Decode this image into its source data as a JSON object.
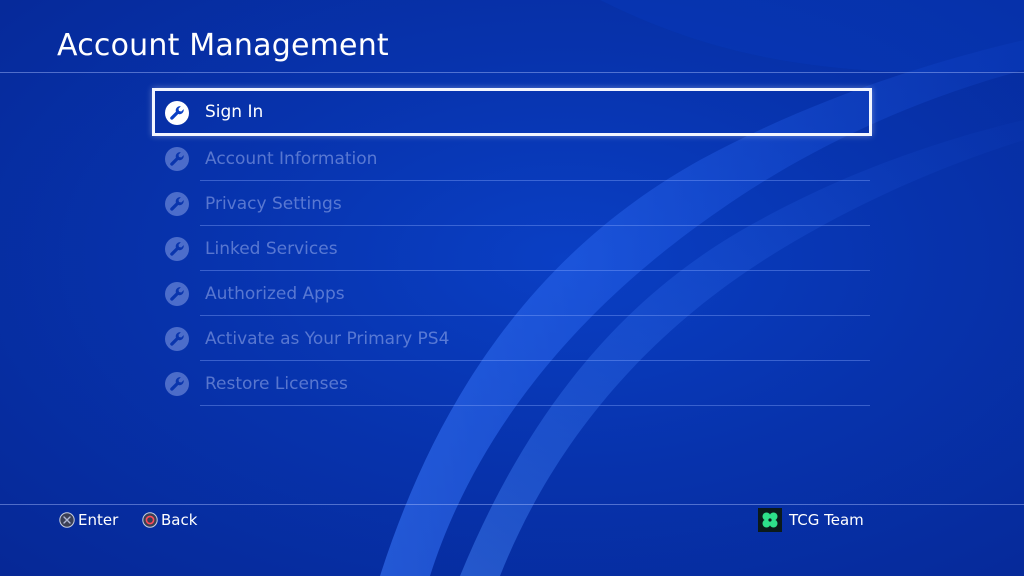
{
  "screen": {
    "title": "Account Management"
  },
  "menu": {
    "items": [
      {
        "label": "Sign In",
        "icon": "wrench-icon",
        "state": "selected"
      },
      {
        "label": "Account Information",
        "icon": "wrench-icon",
        "state": "disabled"
      },
      {
        "label": "Privacy Settings",
        "icon": "wrench-icon",
        "state": "disabled"
      },
      {
        "label": "Linked Services",
        "icon": "wrench-icon",
        "state": "disabled"
      },
      {
        "label": "Authorized Apps",
        "icon": "wrench-icon",
        "state": "disabled"
      },
      {
        "label": "Activate as Your Primary PS4",
        "icon": "wrench-icon",
        "state": "disabled"
      },
      {
        "label": "Restore Licenses",
        "icon": "wrench-icon",
        "state": "disabled"
      }
    ]
  },
  "footer": {
    "enter_label": "Enter",
    "enter_icon": "cross-button-icon",
    "back_label": "Back",
    "back_icon": "circle-button-icon",
    "user_name": "TCG Team",
    "user_icon": "clover-avatar-icon"
  },
  "colors": {
    "background": "#0733ad",
    "selection_border": "#f2f5ff",
    "text": "#ffffff",
    "disabled_text": "#8fa3e6",
    "avatar_green": "#2ee08a"
  }
}
